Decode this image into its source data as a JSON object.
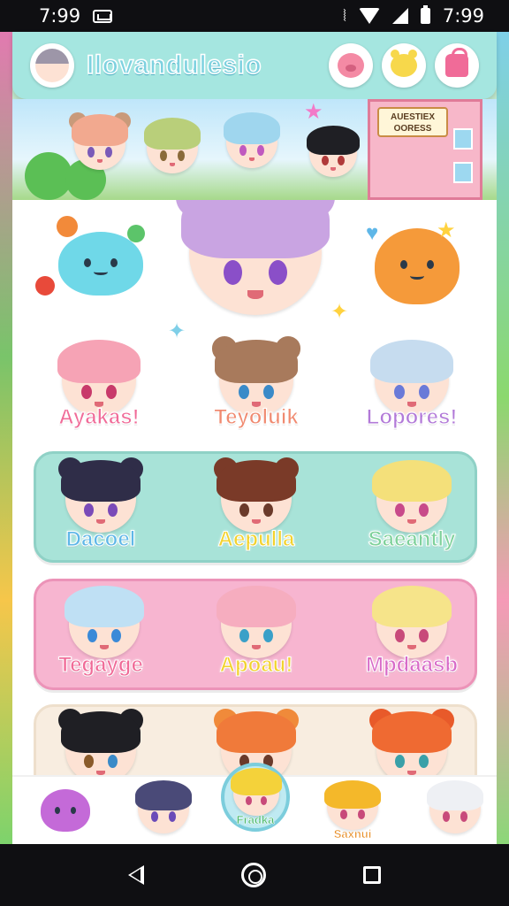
{
  "status_bar": {
    "time_left": "7:99",
    "time_right": "7:99"
  },
  "header": {
    "title": "Ilovandulesio",
    "icons": [
      "pig-icon",
      "bear-icon",
      "shop-bag-icon"
    ]
  },
  "banner": {
    "shop_sign": "AUESTIEX OORESS"
  },
  "featured": {
    "rows": [
      {
        "names": [
          "Ayakas!",
          "Teyoluik",
          "Lopores!"
        ],
        "colors": [
          "#f06b98",
          "#f08a70",
          "#b27ad8"
        ]
      },
      {
        "names": [
          "Dacoel",
          "Aepulla",
          "Saeantly"
        ],
        "colors": [
          "#5fb7e8",
          "#f2d22e",
          "#7ed19a"
        ]
      },
      {
        "names": [
          "Tegayge",
          "Apoau!",
          "Mpdaasb"
        ],
        "colors": [
          "#f06b98",
          "#f2d22e",
          "#d86bc8"
        ]
      }
    ]
  },
  "bottom_nav": {
    "center_label": "Fradka",
    "right_label": "Saxnui"
  },
  "colors": {
    "header_bg": "#a5e6e0",
    "mint_card": "#a8e3d8",
    "pink_card": "#f7b5d0",
    "cream_card": "#f8ede0"
  }
}
